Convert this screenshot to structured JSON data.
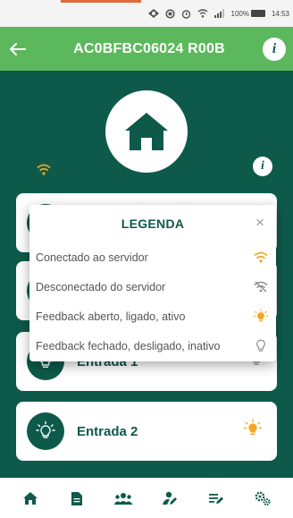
{
  "status_bar": {
    "battery": "100%",
    "time": "14:53"
  },
  "app_bar": {
    "title": "AC0BFBC06024 R00B",
    "back_icon": "arrow-left-icon",
    "info_label": "i"
  },
  "main": {
    "info_label": "i",
    "cards": [
      {
        "label": "Entrada 1",
        "state_icon": "bulb-off-icon"
      },
      {
        "label": "Entrada 2",
        "state_icon": "bulb-on-icon"
      }
    ]
  },
  "legend_modal": {
    "title": "LEGENDA",
    "close": "×",
    "items": [
      {
        "label": "Conectado ao servidor",
        "icon": "wifi-icon",
        "color": "#f5a623"
      },
      {
        "label": "Desconectado do servidor",
        "icon": "wifi-off-icon",
        "color": "#8a8a8a"
      },
      {
        "label": "Feedback aberto, ligado, ativo",
        "icon": "bulb-on-icon",
        "color": "#f5a623"
      },
      {
        "label": "Feedback fechado, desligado, inativo",
        "icon": "bulb-off-icon",
        "color": "#8a8a8a"
      }
    ]
  },
  "bottom_nav": [
    {
      "name": "home",
      "icon": "home-icon"
    },
    {
      "name": "document",
      "icon": "document-icon"
    },
    {
      "name": "users",
      "icon": "users-icon"
    },
    {
      "name": "user-edit",
      "icon": "user-edit-icon"
    },
    {
      "name": "list-edit",
      "icon": "list-edit-icon"
    },
    {
      "name": "settings",
      "icon": "gears-icon"
    }
  ],
  "colors": {
    "primary_dark": "#0e5a4a",
    "app_bar": "#5cb85c",
    "accent": "#f5a623"
  }
}
